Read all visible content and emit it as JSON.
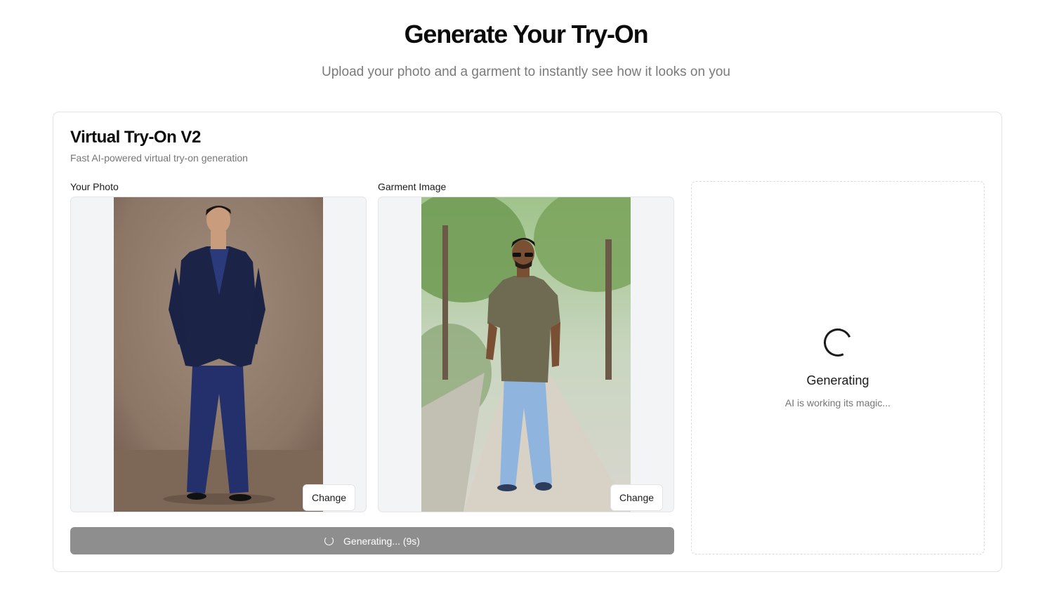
{
  "header": {
    "title": "Generate Your Try-On",
    "subtitle": "Upload your photo and a garment to instantly see how it looks on you"
  },
  "card": {
    "title": "Virtual Try-On V2",
    "description": "Fast AI-powered virtual try-on generation"
  },
  "inputs": {
    "person": {
      "label": "Your Photo",
      "change_label": "Change"
    },
    "garment": {
      "label": "Garment Image",
      "change_label": "Change"
    }
  },
  "generate_button": {
    "label": "Generating... (9s)",
    "state": "disabled"
  },
  "result": {
    "title": "Generating",
    "subtitle": "AI is working its magic..."
  }
}
